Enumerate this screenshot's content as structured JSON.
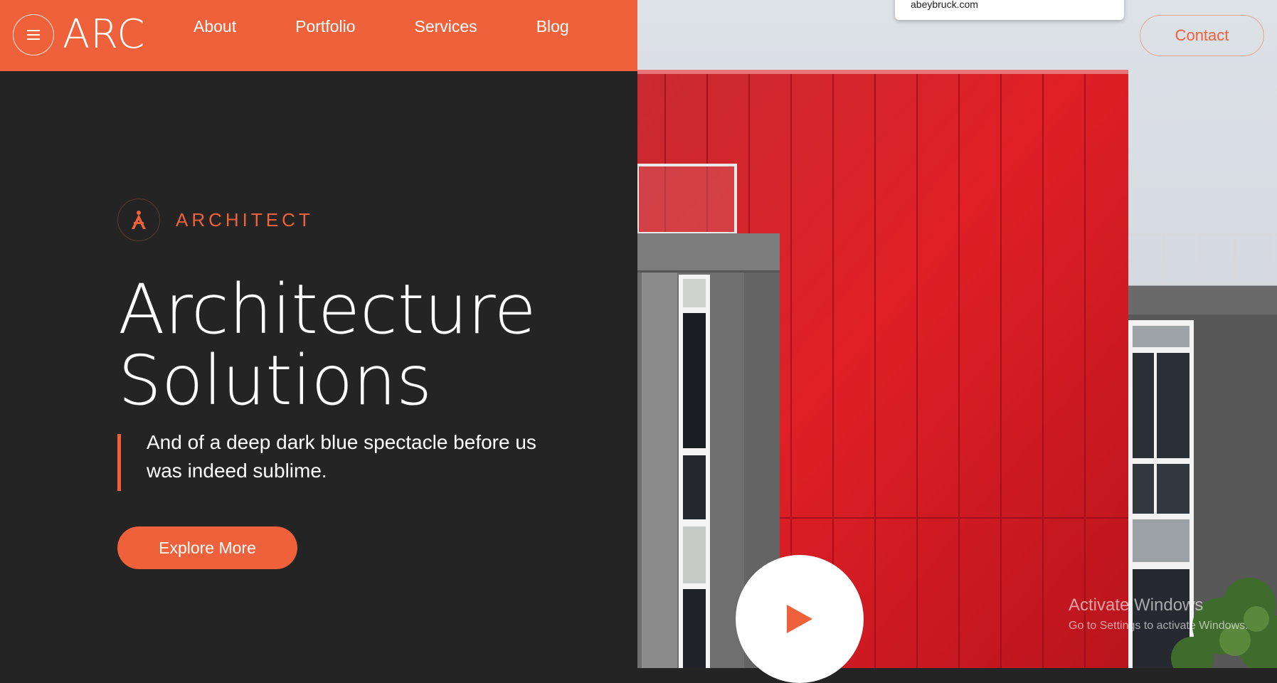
{
  "header": {
    "logo": "ARC",
    "nav": [
      "About",
      "Portfolio",
      "Services",
      "Blog"
    ],
    "contact_label": "Contact",
    "url_hint": "abeybruck.com"
  },
  "hero": {
    "eyebrow": "ARCHITECT",
    "title_line1": "Architecture",
    "title_line2": "Solutions",
    "tagline": "And of a deep dark blue spectacle before us was indeed sublime.",
    "cta_label": "Explore More"
  },
  "watermark": {
    "title": "Activate Windows",
    "subtitle": "Go to Settings to activate Windows."
  },
  "colors": {
    "accent": "#ef613a",
    "panel_bg": "#242425",
    "facade_red": "#d21e28"
  },
  "icons": {
    "menu": "hamburger-icon",
    "eyebrow": "compass-icon",
    "play": "play-icon"
  }
}
